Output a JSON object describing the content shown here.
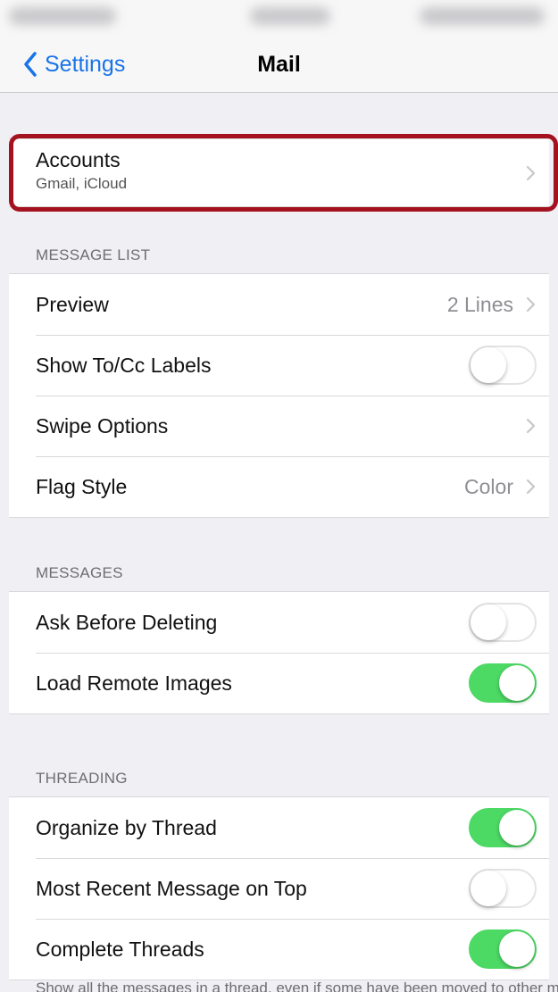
{
  "nav": {
    "back_label": "Settings",
    "title": "Mail"
  },
  "accounts": {
    "title": "Accounts",
    "subtitle": "Gmail, iCloud"
  },
  "message_list": {
    "header": "MESSAGE LIST",
    "rows": [
      {
        "label": "Preview",
        "value": "2 Lines",
        "type": "disclosure"
      },
      {
        "label": "Show To/Cc Labels",
        "type": "toggle",
        "on": false
      },
      {
        "label": "Swipe Options",
        "type": "disclosure"
      },
      {
        "label": "Flag Style",
        "value": "Color",
        "type": "disclosure"
      }
    ]
  },
  "messages": {
    "header": "MESSAGES",
    "rows": [
      {
        "label": "Ask Before Deleting",
        "type": "toggle",
        "on": false
      },
      {
        "label": "Load Remote Images",
        "type": "toggle",
        "on": true
      }
    ]
  },
  "threading": {
    "header": "THREADING",
    "rows": [
      {
        "label": "Organize by Thread",
        "type": "toggle",
        "on": true
      },
      {
        "label": "Most Recent Message on Top",
        "type": "toggle",
        "on": false
      },
      {
        "label": "Complete Threads",
        "type": "toggle",
        "on": true
      }
    ],
    "footer": "Show all the messages in a thread, even if some have been moved to other mailboxes."
  },
  "colors": {
    "accent": "#1a73e8",
    "toggle_on": "#4cd964",
    "highlight": "#a3121e",
    "background": "#efeff4"
  }
}
